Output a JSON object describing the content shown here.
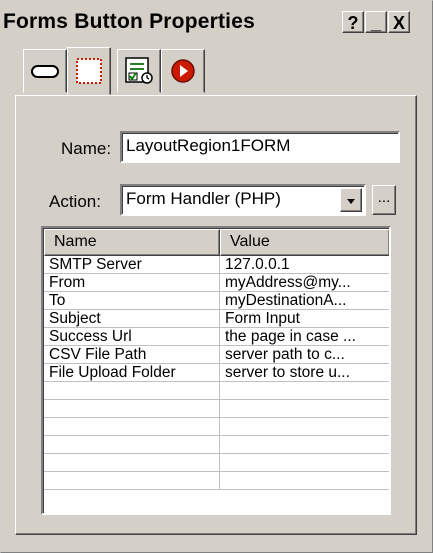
{
  "window": {
    "title": "Forms Button Properties",
    "help_label": "?",
    "minimize_label": "_",
    "close_label": "X"
  },
  "tabs": [
    {
      "icon": "button-shape-icon"
    },
    {
      "icon": "form-region-icon",
      "selected": true
    },
    {
      "icon": "form-checklist-icon"
    },
    {
      "icon": "record-action-icon"
    }
  ],
  "form": {
    "name_label": "Name:",
    "name_value": "LayoutRegion1FORM",
    "action_label": "Action:",
    "action_value": "Form Handler (PHP)",
    "more_label": "..."
  },
  "grid": {
    "columns": [
      "Name",
      "Value"
    ],
    "rows": [
      {
        "name": "SMTP Server",
        "value": "127.0.0.1"
      },
      {
        "name": "From",
        "value": "myAddress@my..."
      },
      {
        "name": "To",
        "value": "myDestinationA..."
      },
      {
        "name": "Subject",
        "value": "Form Input"
      },
      {
        "name": "Success Url",
        "value": "the page in case ..."
      },
      {
        "name": "CSV File Path",
        "value": "server path to c..."
      },
      {
        "name": "File Upload Folder",
        "value": "server to store u..."
      },
      {
        "name": "",
        "value": ""
      },
      {
        "name": "",
        "value": ""
      },
      {
        "name": "",
        "value": ""
      },
      {
        "name": "",
        "value": ""
      },
      {
        "name": "",
        "value": ""
      },
      {
        "name": "",
        "value": ""
      }
    ]
  },
  "colors": {
    "face": "#d4d0c8",
    "record_red": "#cc1a00"
  }
}
